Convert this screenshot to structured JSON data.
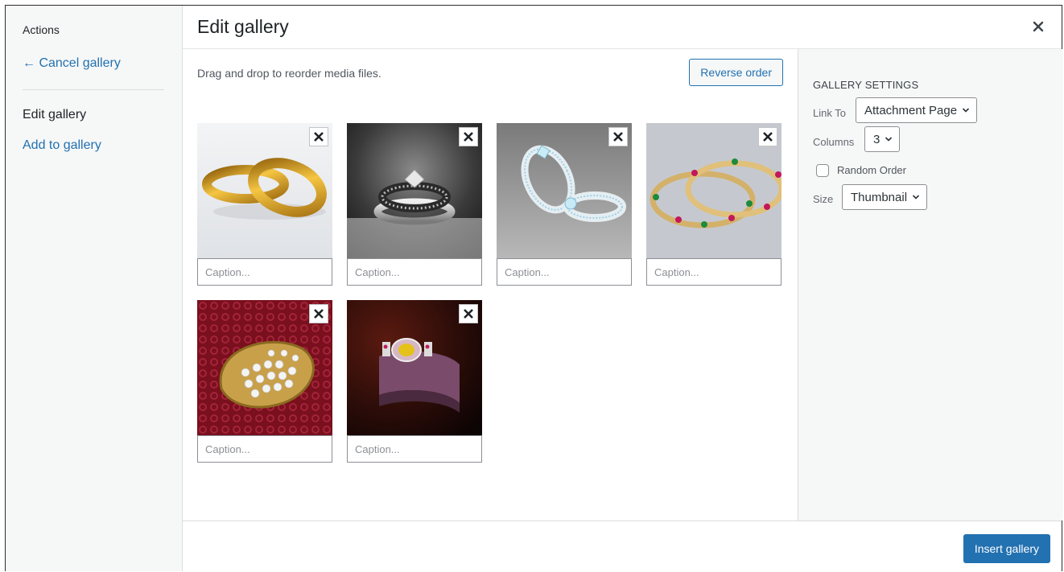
{
  "sidebar": {
    "heading": "Actions",
    "cancel_link": "← Cancel gallery",
    "active_item": "Edit gallery",
    "add_link": "Add to gallery"
  },
  "header": {
    "title": "Edit gallery",
    "close_icon": "close-icon"
  },
  "toolbar": {
    "instructions": "Drag and drop to reorder media files.",
    "reverse_label": "Reverse order"
  },
  "gallery": {
    "items": [
      {
        "image": "gold-wedding-rings",
        "caption_placeholder": "Caption...",
        "caption_value": ""
      },
      {
        "image": "diamond-ring-set-dark",
        "caption_placeholder": "Caption...",
        "caption_value": ""
      },
      {
        "image": "silver-engagement-rings",
        "caption_placeholder": "Caption...",
        "caption_value": ""
      },
      {
        "image": "gemstone-bangles",
        "caption_placeholder": "Caption...",
        "caption_value": ""
      },
      {
        "image": "diamond-cluster-gold-ring",
        "caption_placeholder": "Caption...",
        "caption_value": ""
      },
      {
        "image": "jeweled-cuff-bracelet",
        "caption_placeholder": "Caption...",
        "caption_value": ""
      }
    ]
  },
  "settings": {
    "heading": "Gallery Settings",
    "link_to": {
      "label": "Link To",
      "value": "Attachment Page"
    },
    "columns": {
      "label": "Columns",
      "value": "3"
    },
    "random_order": {
      "label": "Random Order",
      "checked": false
    },
    "size": {
      "label": "Size",
      "value": "Thumbnail"
    }
  },
  "footer": {
    "insert_label": "Insert gallery"
  },
  "colors": {
    "accent": "#2271b1",
    "sidebar_bg": "#f6f7f7",
    "border": "#dcdcde"
  }
}
